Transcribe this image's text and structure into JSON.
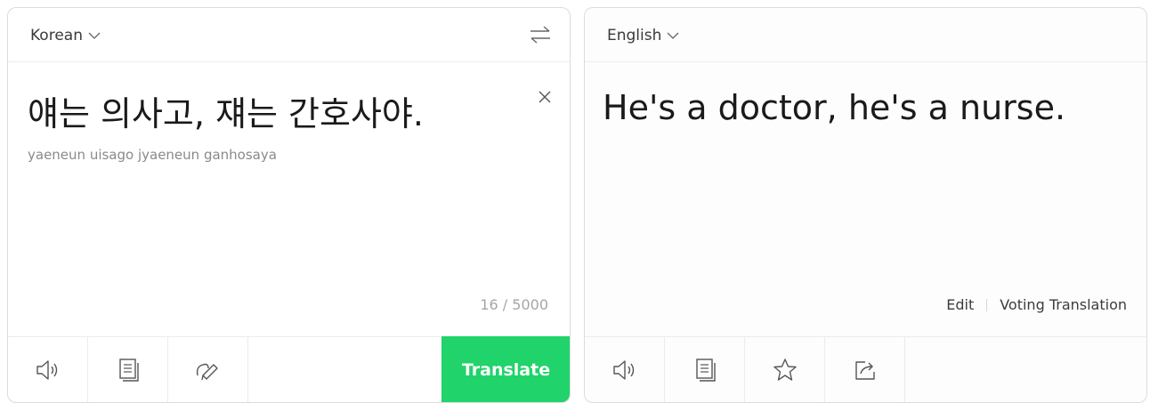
{
  "source": {
    "language": "Korean",
    "text": "얘는 의사고, 쟤는 간호사야.",
    "romanization": "yaeneun uisago jyaeneun ganhosaya",
    "char_count": "16 / 5000",
    "translate_label": "Translate"
  },
  "target": {
    "language": "English",
    "text": "He's a doctor, he's a nurse.",
    "edit_label": "Edit",
    "voting_label": "Voting Translation"
  },
  "icons": {
    "swap": "swap-arrows-icon",
    "clear": "close-icon",
    "speaker": "speaker-icon",
    "copy": "copy-icon",
    "handwriting": "pen-icon",
    "favorite": "star-icon",
    "share": "share-icon"
  },
  "colors": {
    "accent": "#20d36a"
  }
}
